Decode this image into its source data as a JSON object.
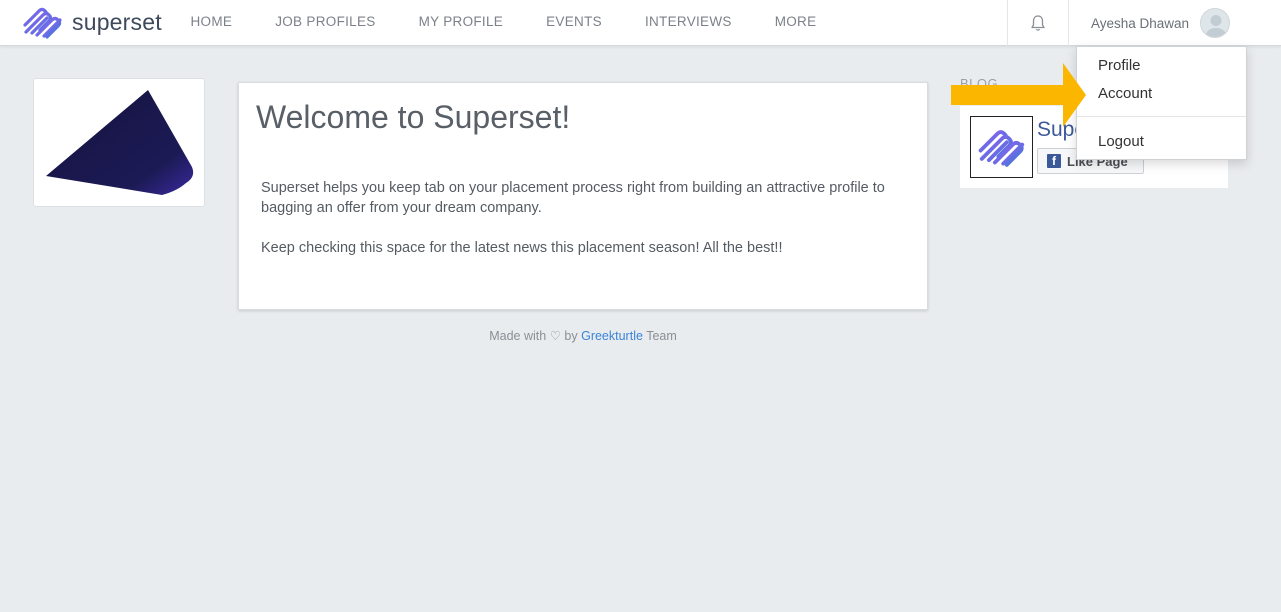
{
  "navbar": {
    "brand": "superset",
    "links": [
      "HOME",
      "JOB PROFILES",
      "MY PROFILE",
      "EVENTS",
      "INTERVIEWS",
      "MORE"
    ],
    "user_name": "Ayesha Dhawan"
  },
  "dropdown": {
    "items": [
      "Profile",
      "Account",
      "Logout"
    ]
  },
  "welcome": {
    "title": "Welcome to Superset!",
    "p1": "Superset helps you keep tab on your placement process right from building an attractive profile to bagging an offer from your dream company.",
    "p2": "Keep checking this space for the latest news this placement season! All the best!!"
  },
  "footer": {
    "made_with": "Made with",
    "by": "by",
    "link": "Greekturtle",
    "team": "Team"
  },
  "blog": {
    "label": "BLOG",
    "page_name": "Superset",
    "like_button": "Like Page"
  },
  "colors": {
    "navbar_bg": "#ffffff",
    "page_bg": "#e9ecef",
    "brand_gradient_start": "#8a5cf6",
    "brand_gradient_end": "#3a7bd5",
    "link": "#3c84d8",
    "facebook": "#3b5998",
    "annotation_arrow": "#fbb700",
    "logo_shape": "#1a1850"
  },
  "icons": {
    "brand": "superset-logo-icon",
    "bell": "bell-icon",
    "avatar": "user-avatar-icon",
    "heart": "heart-icon",
    "facebook": "facebook-icon"
  }
}
